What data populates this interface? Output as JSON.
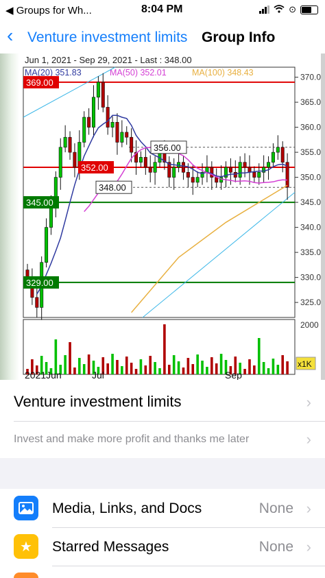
{
  "status_bar": {
    "back_app": "◀ Groups for Wh...",
    "time": "8:04 PM"
  },
  "nav": {
    "back_label": "Venture investment limits",
    "title": "Group Info"
  },
  "chart": {
    "header": "Jun 1, 2021 - Sep 29, 2021 - Last : 348.00",
    "ma": [
      {
        "label": "MA(20)",
        "value": "351.83",
        "color": "#2f3aa0"
      },
      {
        "label": "MA(50)",
        "value": "352.01",
        "color": "#d43fd4"
      },
      {
        "label": "MA(100)",
        "value": "348.43",
        "color": "#e8b040"
      }
    ],
    "y_ticks": [
      "370.0",
      "365.0",
      "360.0",
      "355.0",
      "350.0",
      "345.0",
      "340.0",
      "335.0",
      "330.0",
      "325.0"
    ],
    "price_tags": [
      "369.00",
      "352.00",
      "356.00",
      "348.00",
      "345.00",
      "329.00"
    ],
    "x_labels": [
      "2021Jun",
      "Jul",
      "Sep"
    ],
    "volume_label": "2000",
    "multiplier": "x1K",
    "colors": {
      "up": "#00c000",
      "down": "#b00000",
      "resistance": "#e00000",
      "support": "#007a00"
    }
  },
  "chart_data": {
    "type": "candlestick",
    "x_range": [
      "2021-06-01",
      "2021-09-29"
    ],
    "ylim": [
      322,
      372
    ],
    "last": 348.0,
    "horizontal_levels": [
      369.0,
      352.0,
      345.0,
      329.0
    ],
    "dashed_levels": [
      356.0,
      348.0
    ],
    "moving_averages": [
      {
        "name": "MA(20)",
        "last": 351.83
      },
      {
        "name": "MA(50)",
        "last": 352.01
      },
      {
        "name": "MA(100)",
        "last": 348.43
      }
    ],
    "closes": [
      330,
      326,
      324,
      333,
      340,
      344,
      350,
      356,
      358,
      355,
      352,
      357,
      362,
      360,
      366,
      369,
      364,
      360,
      361,
      357,
      359,
      358,
      355,
      353,
      354,
      352,
      351,
      353,
      355,
      353,
      350,
      352,
      353,
      351,
      350,
      349,
      350,
      351,
      352,
      350,
      349,
      350,
      352,
      351,
      350,
      353,
      352,
      351,
      350,
      351,
      352,
      353,
      355,
      356,
      353,
      348
    ]
  },
  "group": {
    "name": "Venture investment limits",
    "description": "Invest and make more profit and thanks me later"
  },
  "list": [
    {
      "label": "Media, Links, and Docs",
      "value": "None",
      "icon": "photo-icon",
      "color": "#147efb"
    },
    {
      "label": "Starred Messages",
      "value": "None",
      "icon": "star-icon",
      "color": "#ffc107"
    }
  ]
}
